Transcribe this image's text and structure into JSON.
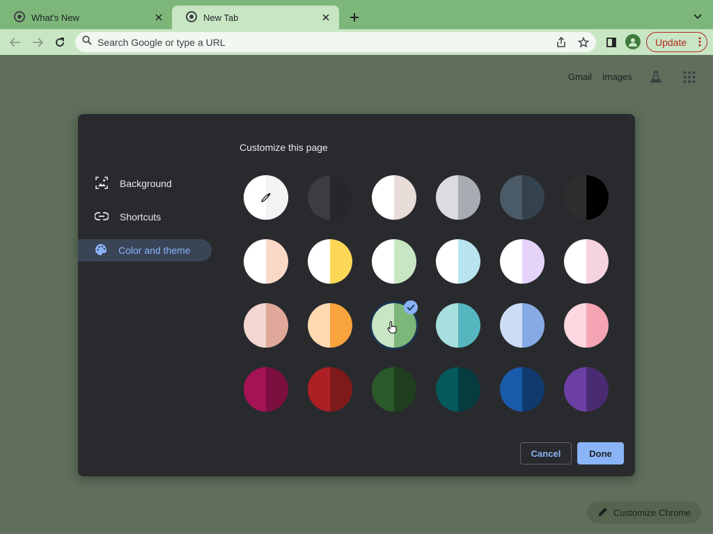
{
  "tabs": [
    {
      "title": "What's New",
      "active": false
    },
    {
      "title": "New Tab",
      "active": true
    }
  ],
  "icons": {
    "tab_favicon": "chrome-icon",
    "new_tab": "plus-icon",
    "tab_search": "chevron-down-icon"
  },
  "toolbar": {
    "omnibox_placeholder": "Search Google or type a URL",
    "update_label": "Update"
  },
  "ntp": {
    "gmail": "Gmail",
    "images": "Images"
  },
  "dialog": {
    "title": "Customize this page",
    "sidebar": [
      {
        "label": "Background",
        "icon": "image-icon",
        "selected": false
      },
      {
        "label": "Shortcuts",
        "icon": "link-icon",
        "selected": false
      },
      {
        "label": "Color and theme",
        "icon": "palette-icon",
        "selected": true
      }
    ],
    "swatches": [
      [
        "#ffffff",
        "#ffffff",
        "custom"
      ],
      [
        "#3c3d40",
        "#26272a",
        ""
      ],
      [
        "#ffffff",
        "#e8dcd8",
        ""
      ],
      [
        "#dadce0",
        "#a9abb3",
        ""
      ],
      [
        "#4a5a66",
        "#34424d",
        ""
      ],
      [
        "#2e2e2e",
        "#000000",
        ""
      ],
      [
        "#ffffff",
        "#fad8c7",
        ""
      ],
      [
        "#ffffff",
        "#fdd857",
        ""
      ],
      [
        "#ffffff",
        "#c8e6c4",
        ""
      ],
      [
        "#ffffff",
        "#b7e4ef",
        ""
      ],
      [
        "#ffffff",
        "#e5d4fa",
        ""
      ],
      [
        "#ffffff",
        "#f6d3e1",
        ""
      ],
      [
        "#f2d6cf",
        "#e0a89a",
        ""
      ],
      [
        "#ffd9b0",
        "#f9a33d",
        ""
      ],
      [
        "#c8e6c4",
        "#7cb679",
        "selected"
      ],
      [
        "#a7dede",
        "#56b6bf",
        ""
      ],
      [
        "#cddcf5",
        "#86abe4",
        ""
      ],
      [
        "#fcd7df",
        "#f5a4b4",
        ""
      ],
      [
        "#a51354",
        "#7b1040",
        ""
      ],
      [
        "#ad1f22",
        "#7e1a1a",
        ""
      ],
      [
        "#2b5a2a",
        "#1f3d1f",
        ""
      ],
      [
        "#05595c",
        "#063c40",
        ""
      ],
      [
        "#1a5aab",
        "#103a6e",
        ""
      ],
      [
        "#6b3fa4",
        "#4a2b73",
        ""
      ]
    ],
    "cancel_label": "Cancel",
    "done_label": "Done"
  },
  "customize_chrome_label": "Customize Chrome"
}
